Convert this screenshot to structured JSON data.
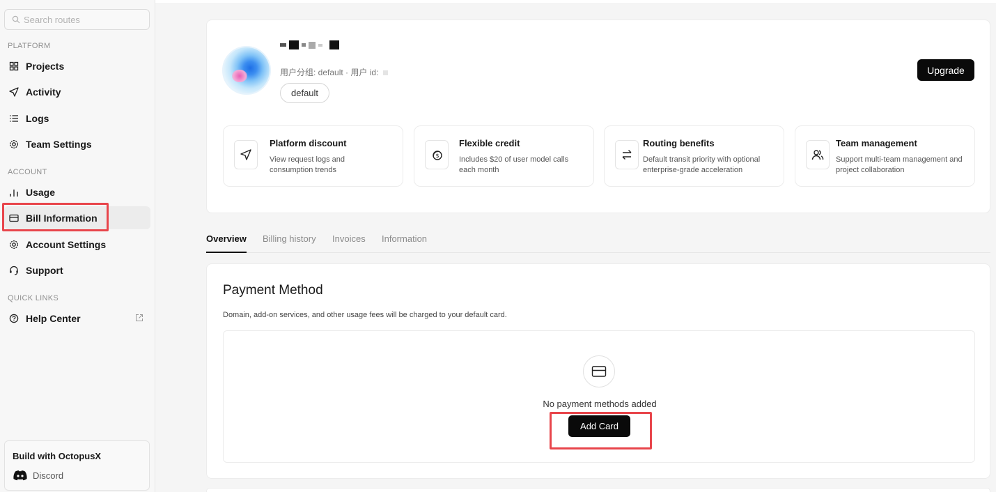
{
  "sidebar": {
    "search_placeholder": "Search routes",
    "sections": {
      "platform": "PLATFORM",
      "account": "ACCOUNT",
      "quick_links": "QUICK LINKS"
    },
    "items": [
      {
        "label": "Projects",
        "icon": "grid-icon"
      },
      {
        "label": "Activity",
        "icon": "send-icon"
      },
      {
        "label": "Logs",
        "icon": "list-icon"
      },
      {
        "label": "Team Settings",
        "icon": "gear-icon"
      },
      {
        "label": "Usage",
        "icon": "bar-chart-icon"
      },
      {
        "label": "Bill Information",
        "icon": "credit-card-icon",
        "active": true
      },
      {
        "label": "Account Settings",
        "icon": "gear-icon"
      },
      {
        "label": "Support",
        "icon": "headset-icon"
      },
      {
        "label": "Help Center",
        "icon": "help-circle-icon"
      }
    ],
    "build": {
      "title": "Build with OctopusX",
      "discord_label": "Discord"
    }
  },
  "profile": {
    "meta": "用户分组: default · 用户 id:",
    "group": "default",
    "upgrade_label": "Upgrade"
  },
  "features": [
    {
      "title": "Platform discount",
      "desc": "View request logs and consumption trends",
      "icon": "send-icon"
    },
    {
      "title": "Flexible credit",
      "desc": "Includes $20 of user model calls each month",
      "icon": "coins-icon"
    },
    {
      "title": "Routing benefits",
      "desc": "Default transit priority with optional enterprise-grade acceleration",
      "icon": "swap-icon"
    },
    {
      "title": "Team management",
      "desc": "Support multi-team management and project collaboration",
      "icon": "users-icon"
    }
  ],
  "tabs": [
    "Overview",
    "Billing history",
    "Invoices",
    "Information"
  ],
  "active_tab": "Overview",
  "payment": {
    "title": "Payment Method",
    "description": "Domain, add-on services, and other usage fees will be charged to your default card.",
    "empty_text": "No payment methods added",
    "add_card_label": "Add Card"
  },
  "colors": {
    "accent": "#0a0a0a",
    "highlight": "#e8454b"
  }
}
